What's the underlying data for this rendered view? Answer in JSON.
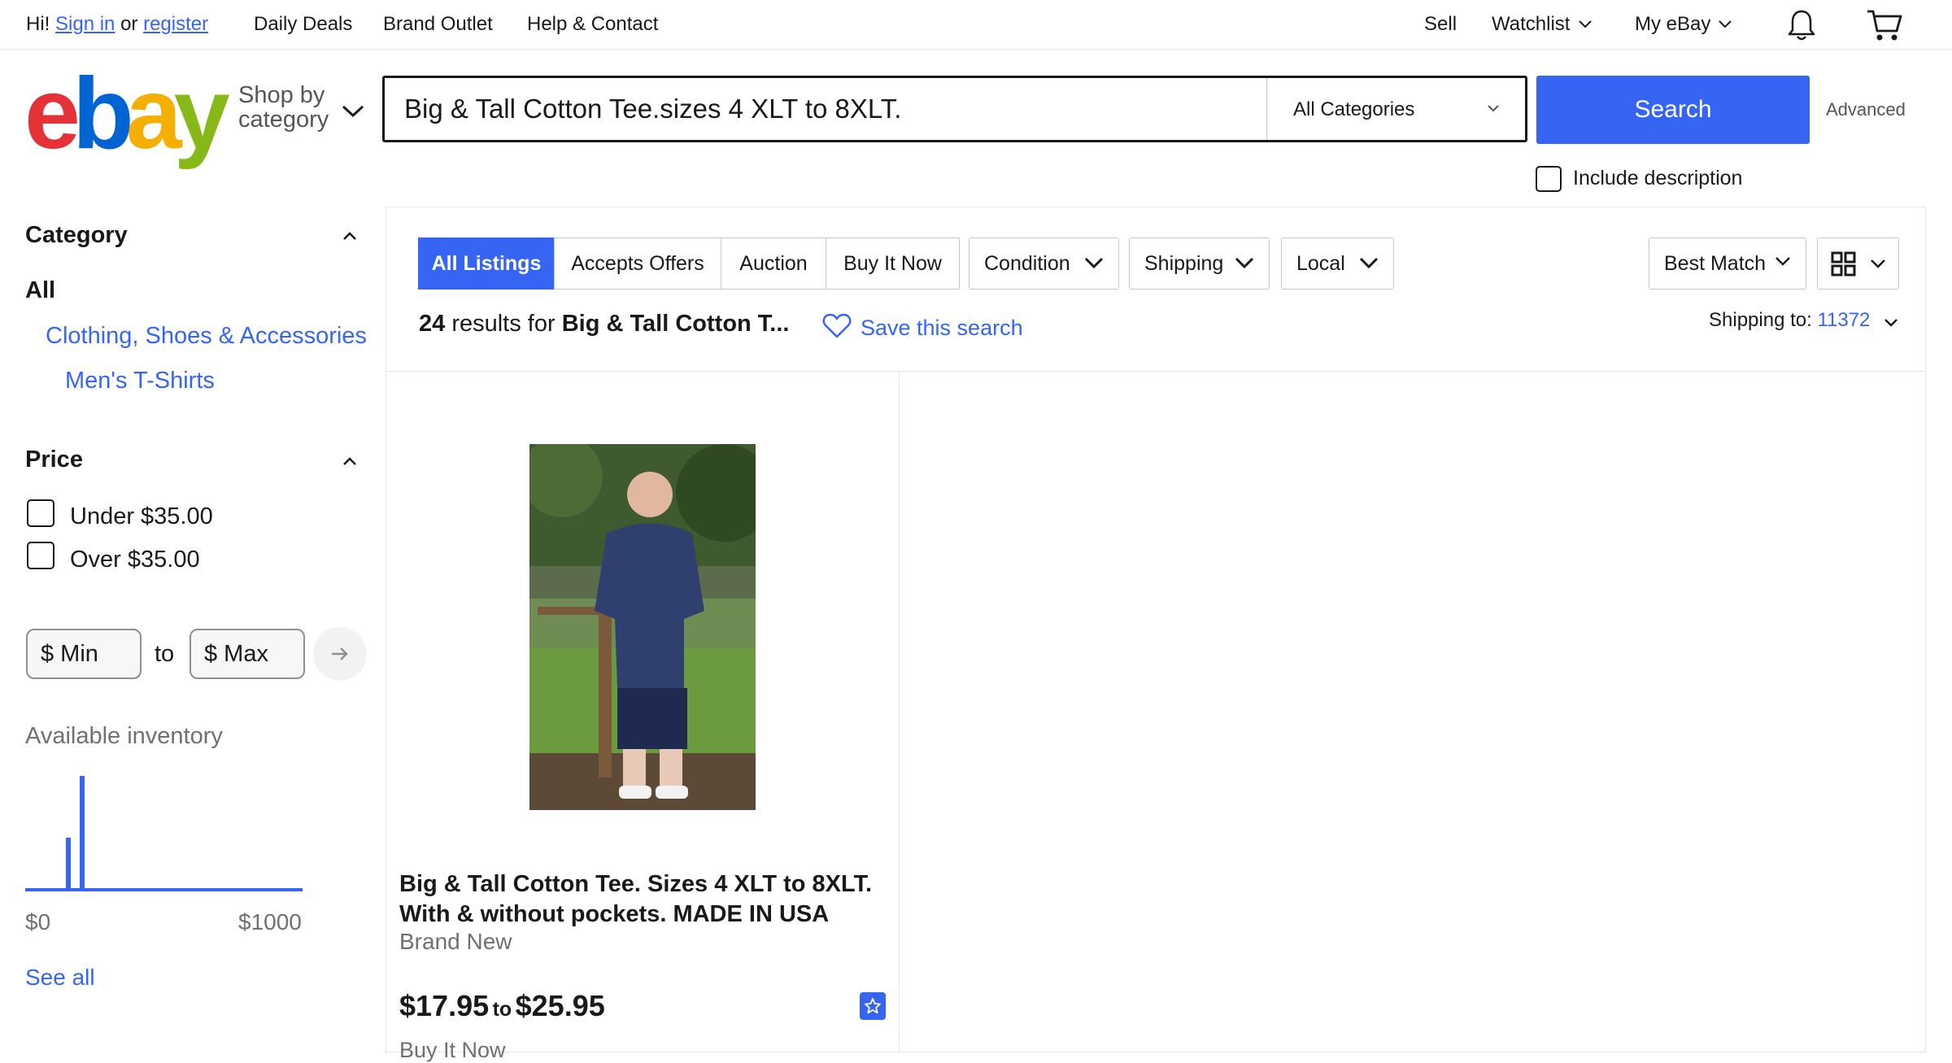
{
  "topbar": {
    "hi": "Hi!",
    "sign_in": "Sign in",
    "or": "or",
    "register": "register",
    "daily_deals": "Daily Deals",
    "brand_outlet": "Brand Outlet",
    "help_contact": "Help & Contact",
    "sell": "Sell",
    "watchlist": "Watchlist",
    "my_ebay": "My eBay"
  },
  "header": {
    "logo_letters": [
      "e",
      "b",
      "a",
      "y"
    ],
    "logo_colors": [
      "#e53238",
      "#0064d2",
      "#f5af02",
      "#86b817"
    ],
    "shop_by_line1": "Shop by",
    "shop_by_line2": "category",
    "search_value": "Big & Tall Cotton Tee.sizes 4 XLT to 8XLT.",
    "category_select": "All Categories",
    "search_button": "Search",
    "advanced": "Advanced",
    "include_description": "Include description"
  },
  "sidebar": {
    "category_heading": "Category",
    "category_all": "All",
    "category_links": [
      "Clothing, Shoes & Accessories",
      "Men's T-Shirts"
    ],
    "price_heading": "Price",
    "price_options": [
      "Under $35.00",
      "Over $35.00"
    ],
    "min_placeholder": "$ Min",
    "to": "to",
    "max_placeholder": "$ Max",
    "inventory_label": "Available inventory",
    "inventory_min": "$0",
    "inventory_max": "$1000",
    "see_all": "See all"
  },
  "filters": {
    "tabs": [
      "All Listings",
      "Accepts Offers",
      "Auction",
      "Buy It Now"
    ],
    "active_tab": "All Listings",
    "dropdowns": [
      "Condition",
      "Shipping",
      "Local"
    ],
    "sort": "Best Match"
  },
  "results": {
    "count": "24",
    "results_for": "results for",
    "query_truncated": "Big & Tall Cotton T...",
    "save_search": "Save this search",
    "shipping_to_label": "Shipping to:",
    "zip": "11372"
  },
  "item": {
    "title": "Big & Tall Cotton Tee. Sizes 4 XLT to 8XLT. With & without pockets. MADE IN USA",
    "condition": "Brand New",
    "price_low": "$17.95",
    "price_to": "to",
    "price_high": "$25.95",
    "buy_format": "Buy It Now"
  },
  "colors": {
    "accent": "#3665f3",
    "text": "#191919",
    "muted": "#707070"
  }
}
